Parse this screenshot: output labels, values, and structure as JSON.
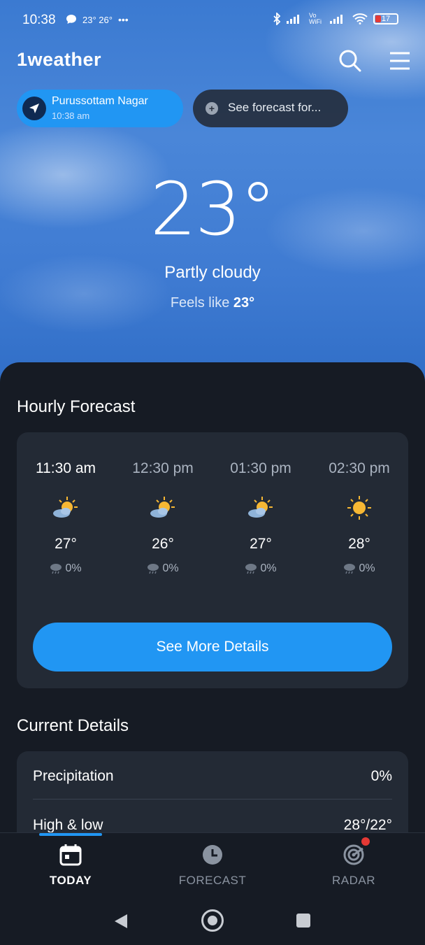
{
  "status_bar": {
    "time": "10:38",
    "notif_temps": "23° 26°",
    "more": "•••",
    "battery": "17",
    "network_label": "Vo WiFi"
  },
  "header": {
    "logo": "1weather",
    "search_icon": "search-icon",
    "menu_icon": "hamburger-menu-icon"
  },
  "location": {
    "name": "Purussottam Nagar",
    "time": "10:38 am",
    "see_forecast": "See forecast for..."
  },
  "current": {
    "temperature": "23°",
    "condition": "Partly cloudy",
    "feels_label": "Feels like",
    "feels_value": "23°"
  },
  "hourly": {
    "title": "Hourly Forecast",
    "items": [
      {
        "time": "11:30 am",
        "icon": "partly-sunny-icon",
        "temp": "27°",
        "precip": "0%"
      },
      {
        "time": "12:30 pm",
        "icon": "partly-sunny-icon",
        "temp": "26°",
        "precip": "0%"
      },
      {
        "time": "01:30 pm",
        "icon": "partly-sunny-icon",
        "temp": "27°",
        "precip": "0%"
      },
      {
        "time": "02:30 pm",
        "icon": "sunny-icon",
        "temp": "28°",
        "precip": "0%"
      }
    ],
    "see_more": "See More Details"
  },
  "details": {
    "title": "Current Details",
    "rows": [
      {
        "label": "Precipitation",
        "value": "0%"
      },
      {
        "label": "High & low",
        "value": "28°/22°"
      }
    ]
  },
  "nav": {
    "items": [
      {
        "label": "TODAY",
        "icon": "calendar-icon",
        "active": true
      },
      {
        "label": "FORECAST",
        "icon": "clock-icon",
        "active": false
      },
      {
        "label": "RADAR",
        "icon": "radar-icon",
        "active": false
      }
    ]
  },
  "colors": {
    "accent": "#2196f3",
    "sheet_bg": "#161b24",
    "card_bg": "#232a35",
    "sky": "#3f7bd2",
    "alert_dot": "#e53935"
  }
}
